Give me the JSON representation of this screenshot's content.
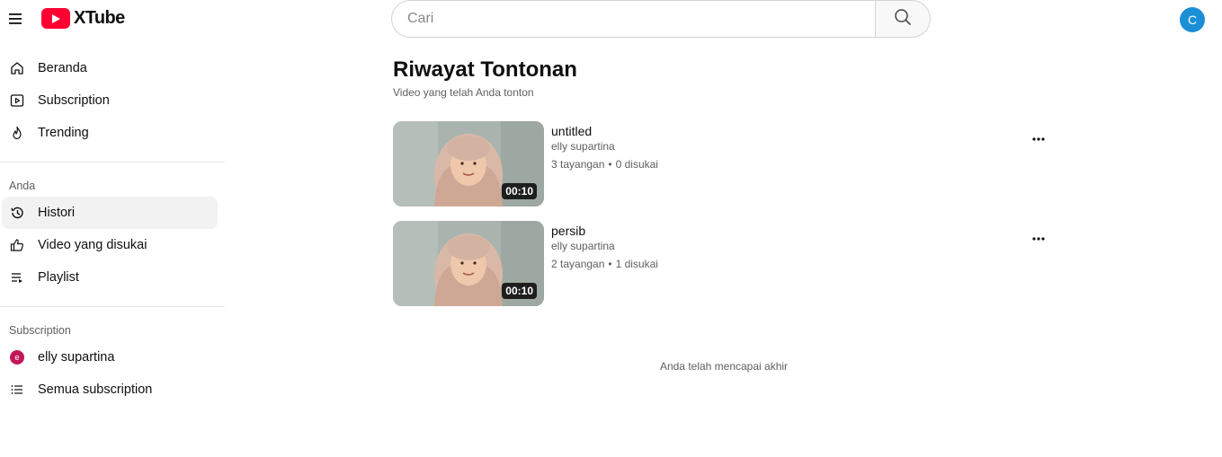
{
  "app": {
    "name": "XTube",
    "brand_color": "#ff0033"
  },
  "search": {
    "placeholder": "Cari"
  },
  "user": {
    "avatar_letter": "C",
    "avatar_color": "#1a8fd6"
  },
  "sidebar": {
    "main_items": [
      {
        "label": "Beranda",
        "icon": "home-icon"
      },
      {
        "label": "Subscription",
        "icon": "subscriptions-icon"
      },
      {
        "label": "Trending",
        "icon": "fire-icon"
      }
    ],
    "you_section": {
      "title": "Anda",
      "items": [
        {
          "label": "Histori",
          "icon": "history-icon",
          "active": true
        },
        {
          "label": "Video yang disukai",
          "icon": "thumbs-up-icon"
        },
        {
          "label": "Playlist",
          "icon": "playlist-icon"
        }
      ]
    },
    "subscription_section": {
      "title": "Subscription",
      "items": [
        {
          "label": "elly supartina",
          "avatar_letter": "e"
        },
        {
          "label": "Semua subscription",
          "icon": "list-icon"
        }
      ]
    }
  },
  "main": {
    "title": "Riwayat Tontonan",
    "subtitle": "Video yang telah Anda tonton",
    "videos": [
      {
        "title": "untitled",
        "channel": "elly supartina",
        "views": "3 tayangan",
        "likes": "0 disukai",
        "duration": "00:10"
      },
      {
        "title": "persib",
        "channel": "elly supartina",
        "views": "2 tayangan",
        "likes": "1 disukai",
        "duration": "00:10"
      }
    ],
    "end_message": "Anda telah mencapai akhir"
  }
}
